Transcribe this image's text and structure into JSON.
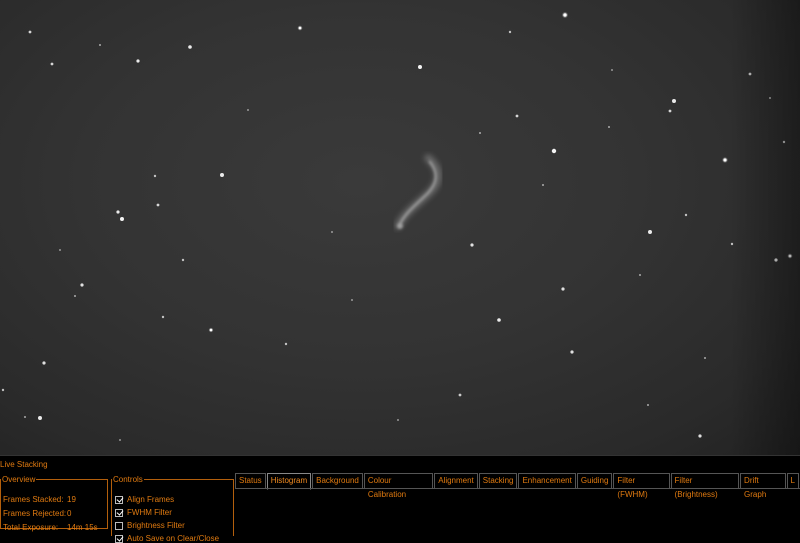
{
  "window": {
    "title": "Live Stacking"
  },
  "overview": {
    "legend": "Overview",
    "rows": [
      {
        "label": "Frames Stacked:",
        "value": "19"
      },
      {
        "label": "Frames Rejected:",
        "value": "0"
      },
      {
        "label": "Total Exposure:",
        "value": "14m 15s"
      }
    ]
  },
  "controls": {
    "legend": "Controls",
    "items": [
      {
        "label": "Align Frames",
        "checked": true
      },
      {
        "label": "FWHM Filter",
        "checked": true
      },
      {
        "label": "Brightness Filter",
        "checked": false
      },
      {
        "label": "Auto Save on Clear/Close",
        "checked": true
      }
    ]
  },
  "tabs": [
    {
      "label": "Status",
      "active": false
    },
    {
      "label": "Histogram",
      "active": true
    },
    {
      "label": "Background",
      "active": false
    },
    {
      "label": "Colour Calibration",
      "active": false
    },
    {
      "label": "Alignment",
      "active": false
    },
    {
      "label": "Stacking",
      "active": false
    },
    {
      "label": "Enhancement",
      "active": false
    },
    {
      "label": "Guiding",
      "active": false
    },
    {
      "label": "Filter (FWHM)",
      "active": false
    },
    {
      "label": "Filter (Brightness)",
      "active": false
    },
    {
      "label": "Drift Graph",
      "active": false
    },
    {
      "label": "L",
      "active": false
    }
  ],
  "colors": {
    "accent": "#e07a10",
    "border": "#b35f0c",
    "sky": "#333333"
  }
}
